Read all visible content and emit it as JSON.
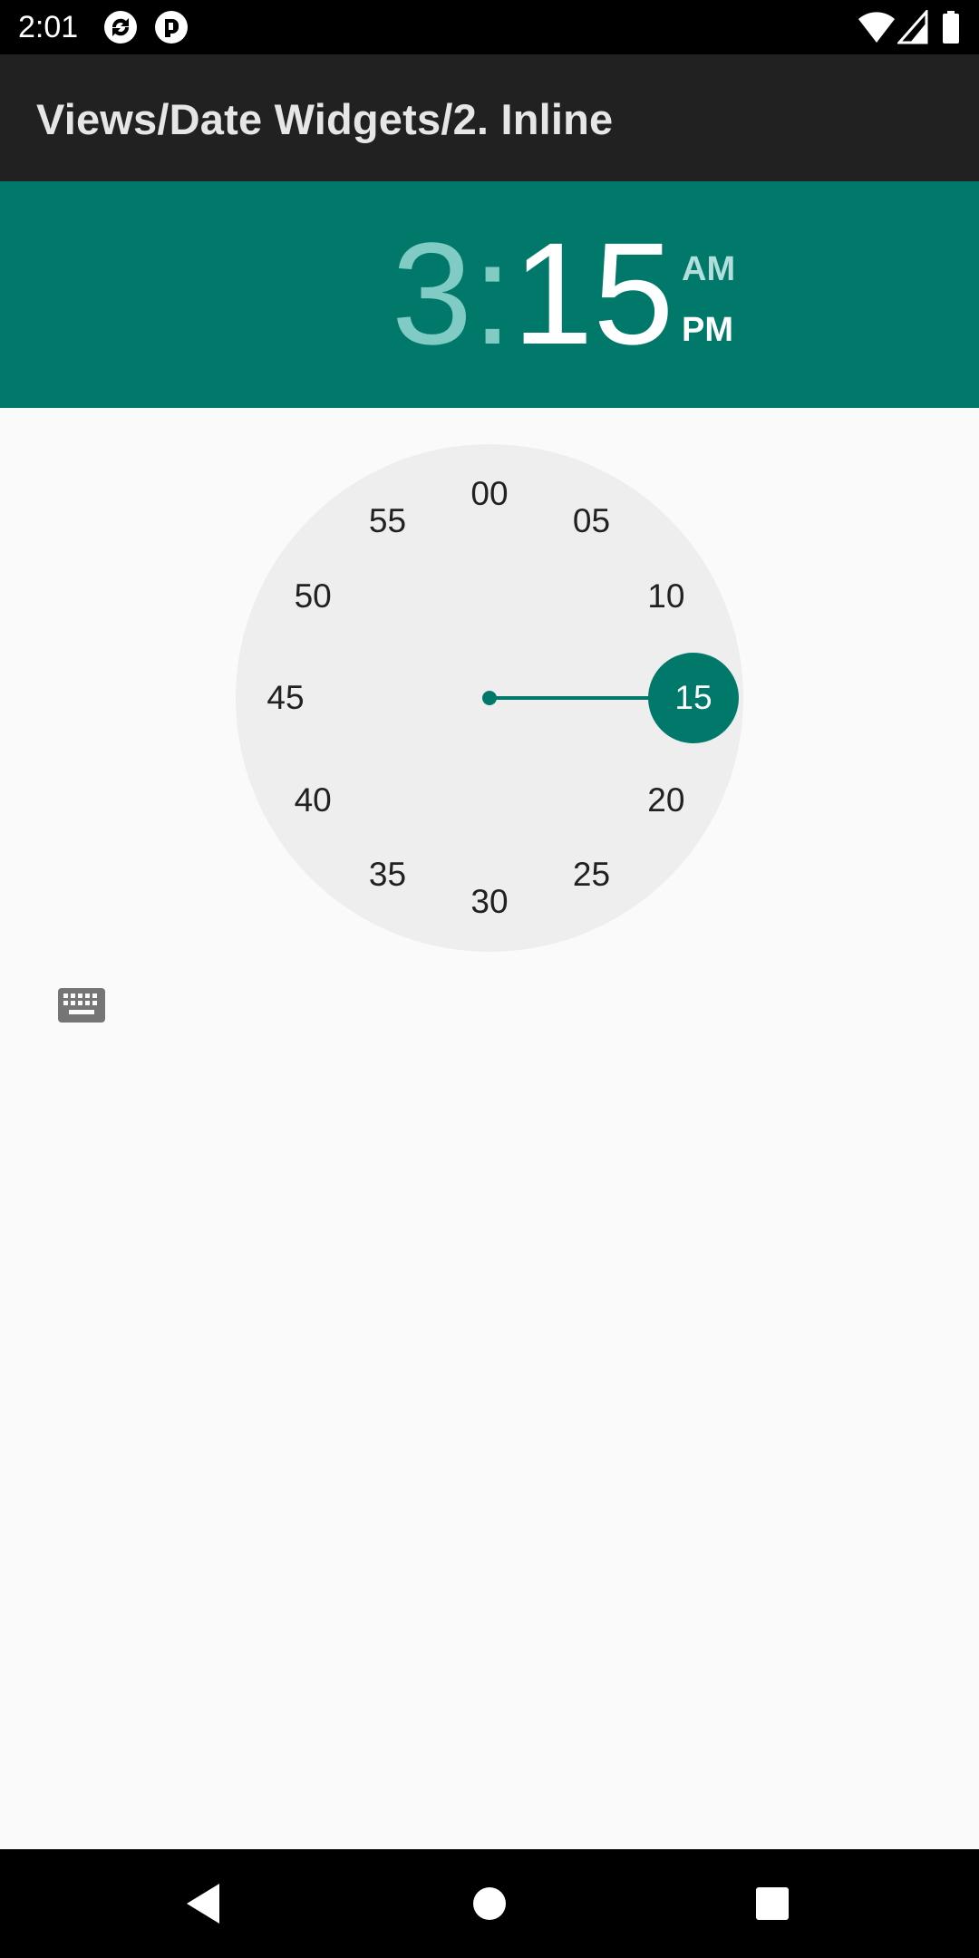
{
  "status_bar": {
    "time": "2:01",
    "icons_left": [
      "sync-app-icon",
      "notification-app-icon"
    ],
    "icons_right": [
      "wifi-icon",
      "signal-icon",
      "battery-icon"
    ]
  },
  "app_bar": {
    "title": "Views/Date Widgets/2. Inline"
  },
  "time_header": {
    "hour": "3",
    "separator": ":",
    "minute": "15",
    "am_label": "AM",
    "pm_label": "PM",
    "selected_period": "PM"
  },
  "clock": {
    "mode": "minutes",
    "labels": [
      "00",
      "05",
      "10",
      "15",
      "20",
      "25",
      "30",
      "35",
      "40",
      "45",
      "50",
      "55"
    ],
    "selected": "15"
  },
  "colors": {
    "accent": "#00796b",
    "accent_light": "#80cbc4",
    "app_bar": "#212121",
    "clock_face": "#eeeeee",
    "background": "#fafafa"
  },
  "keyboard_toggle": {
    "icon": "keyboard-icon"
  },
  "nav_bar": {
    "icons": [
      "back-icon",
      "home-icon",
      "recents-icon"
    ]
  }
}
